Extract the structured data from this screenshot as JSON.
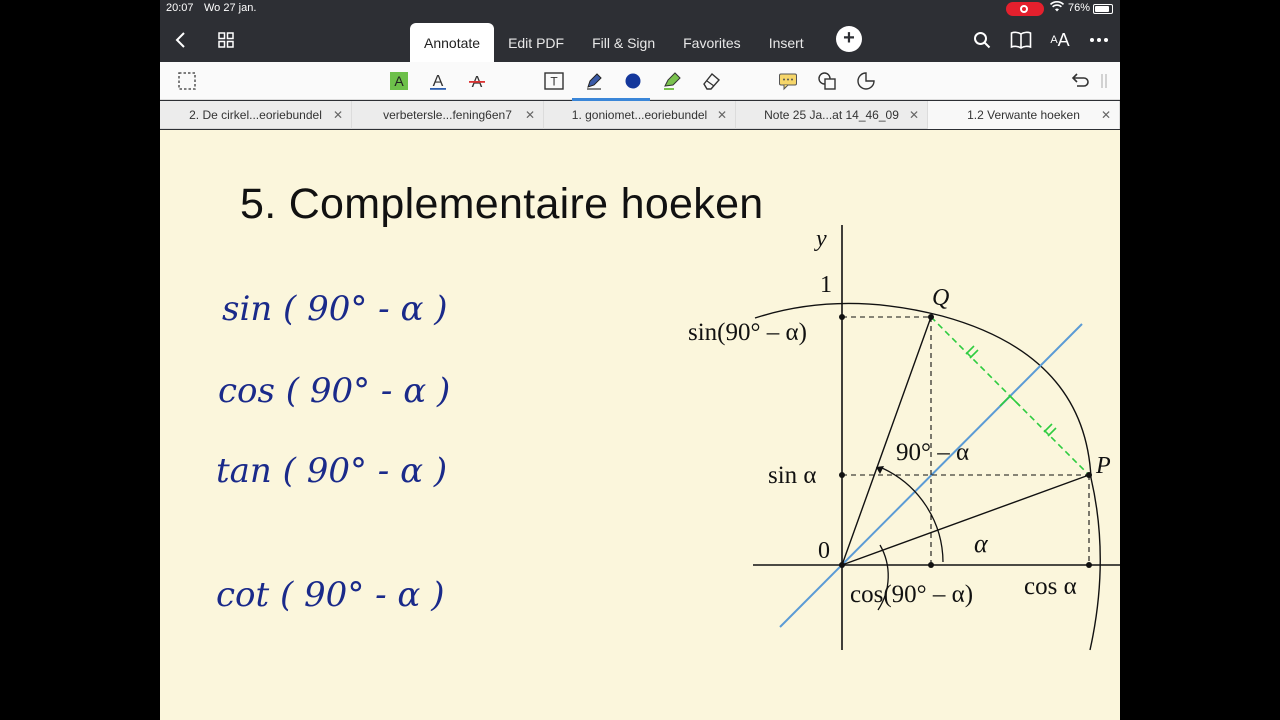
{
  "status": {
    "time": "20:07",
    "date": "Wo 27 jan.",
    "battery": "76%",
    "battery_level": 0.76
  },
  "nav": {
    "tabs": [
      "Annotate",
      "Edit PDF",
      "Fill & Sign",
      "Favorites",
      "Insert"
    ],
    "active_tab": "Annotate"
  },
  "doc_tabs": [
    {
      "label": "2. De cirkel...eoriebundel",
      "active": false
    },
    {
      "label": "verbetersle...fening6en7",
      "active": false
    },
    {
      "label": "1. goniomet...eoriebundel",
      "active": false
    },
    {
      "label": "Note 25 Ja...at 14_46_09",
      "active": false
    },
    {
      "label": "1.2 Verwante hoeken",
      "active": true
    }
  ],
  "page": {
    "title": "5. Complementaire hoeken",
    "handwriting": [
      "sin ( 90° - α )",
      "cos ( 90° - α )",
      "tan ( 90° - α )",
      "cot ( 90° - α )"
    ],
    "figure": {
      "y_axis": "y",
      "one": "1",
      "zero": "0",
      "Q": "Q",
      "P": "P",
      "sin_comp": "sin(90° – α)",
      "sin_a": "sin α",
      "angle_comp": "90° – α",
      "alpha": "α",
      "cos_comp": "cos(90° – α)",
      "cos_a": "cos α"
    }
  },
  "colors": {
    "page_bg": "#fbf6dc",
    "ink": "#1a2a8a",
    "accent": "#3a86d8",
    "bisector": "#5b9bd5",
    "chord": "#2ecc40"
  }
}
